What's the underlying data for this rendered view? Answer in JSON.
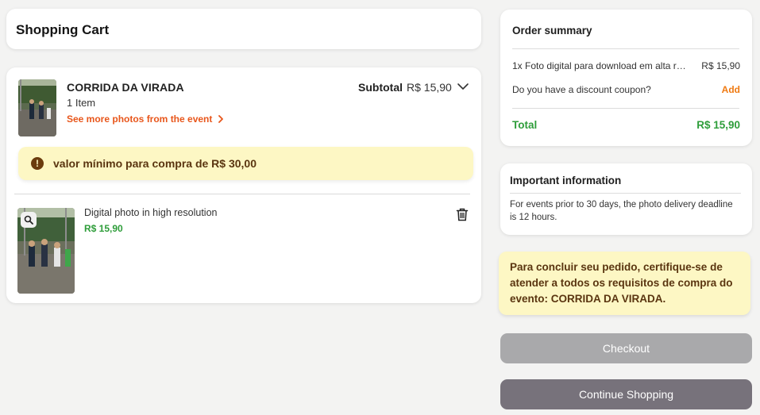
{
  "header": {
    "title": "Shopping Cart"
  },
  "cart": {
    "event_name": "CORRIDA DA VIRADA",
    "item_count": "1 Item",
    "more_photos_link": "See more photos from the event",
    "subtotal_label": "Subtotal",
    "subtotal_value": "R$ 15,90",
    "min_purchase_alert": "valor mínimo para compra de R$ 30,00",
    "items": [
      {
        "title": "Digital photo in high resolution",
        "price": "R$ 15,90"
      }
    ]
  },
  "order_summary": {
    "title": "Order summary",
    "line_item": "1x Foto digital para download em alta resolução",
    "line_price": "R$ 15,90",
    "coupon_question": "Do you have a discount coupon?",
    "coupon_add": "Add",
    "total_label": "Total",
    "total_value": "R$ 15,90"
  },
  "important_info": {
    "title": "Important information",
    "text": "For events prior to 30 days, the photo delivery deadline is 12 hours."
  },
  "requirements_notice": "Para concluir seu pedido, certifique-se de atender a todos os requisitos de compra do evento: CORRIDA DA VIRADA.",
  "buttons": {
    "checkout": "Checkout",
    "continue_shopping": "Continue Shopping"
  },
  "colors": {
    "accent_orange": "#e8561b",
    "price_green": "#2e9d3a",
    "alert_yellow": "#fdf7c4",
    "checkout_disabled": "#a9a9ab",
    "continue_button": "#77727b"
  },
  "icons": [
    "chevron-right-icon",
    "chevron-down-icon",
    "exclamation-icon",
    "search-icon",
    "trash-icon"
  ]
}
